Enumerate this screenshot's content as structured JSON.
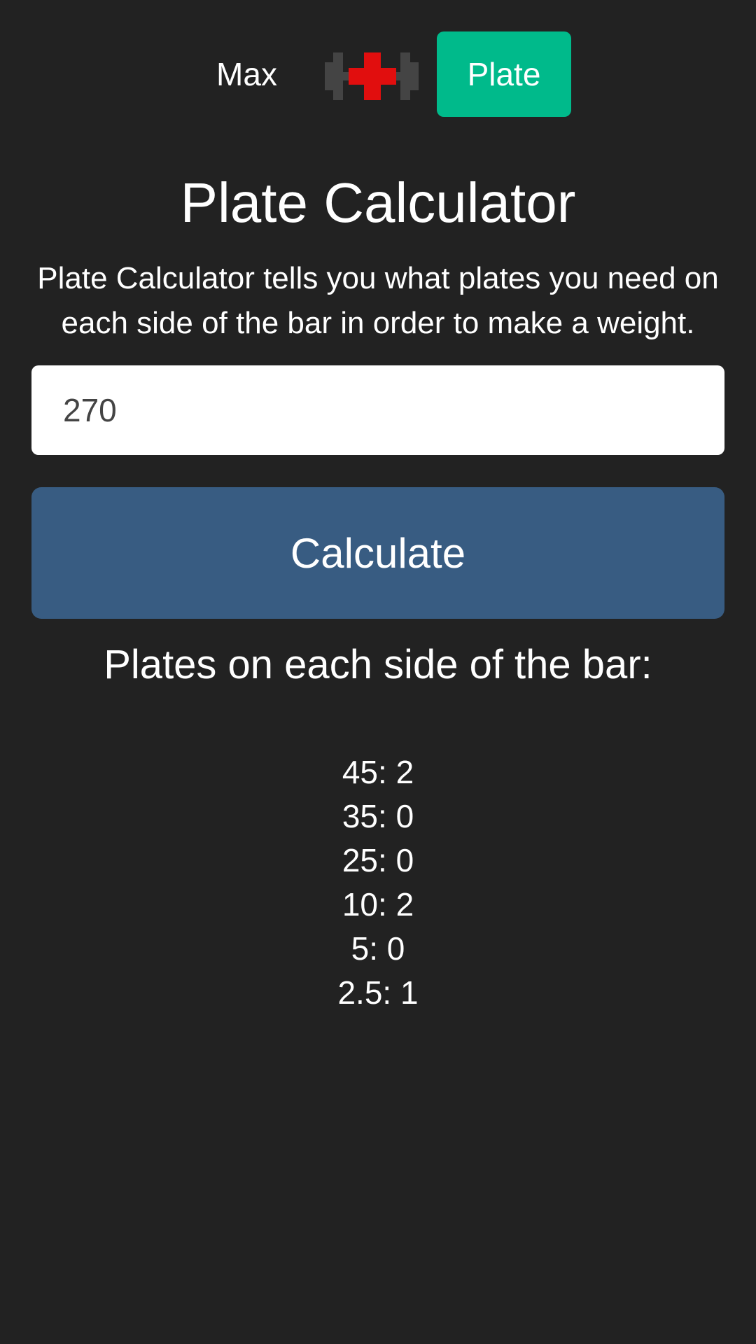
{
  "nav": {
    "max_label": "Max",
    "plate_label": "Plate",
    "logo_icon": "dumbbell-medical-cross-icon",
    "active_color": "#00ba8b"
  },
  "main": {
    "title": "Plate Calculator",
    "description": "Plate Calculator tells you what plates you need on each side of the bar in order to make a weight.",
    "weight_input_value": "270",
    "calculate_label": "Calculate",
    "calculate_color": "#385c82",
    "result_heading": "Plates on each side of the bar:"
  },
  "results": [
    "45: 2",
    "35: 0",
    "25: 0",
    "10: 2",
    "5: 0",
    "2.5: 1"
  ]
}
